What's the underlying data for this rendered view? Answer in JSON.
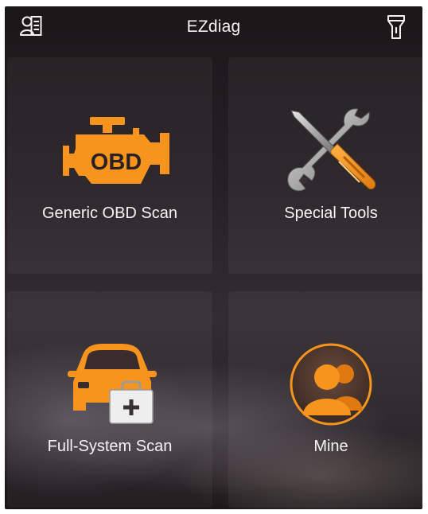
{
  "header": {
    "title": "EZdiag",
    "left_icon": "user-list-icon",
    "right_icon": "flashlight-icon"
  },
  "tiles": [
    {
      "label": "Generic OBD Scan",
      "icon": "engine-obd-icon",
      "icon_text": "OBD"
    },
    {
      "label": "Special Tools",
      "icon": "wrench-screwdriver-icon"
    },
    {
      "label": "Full-System Scan",
      "icon": "car-medkit-icon"
    },
    {
      "label": "Mine",
      "icon": "user-avatar-icon"
    }
  ],
  "colors": {
    "accent": "#f7941d",
    "text": "#f4f4f4"
  }
}
